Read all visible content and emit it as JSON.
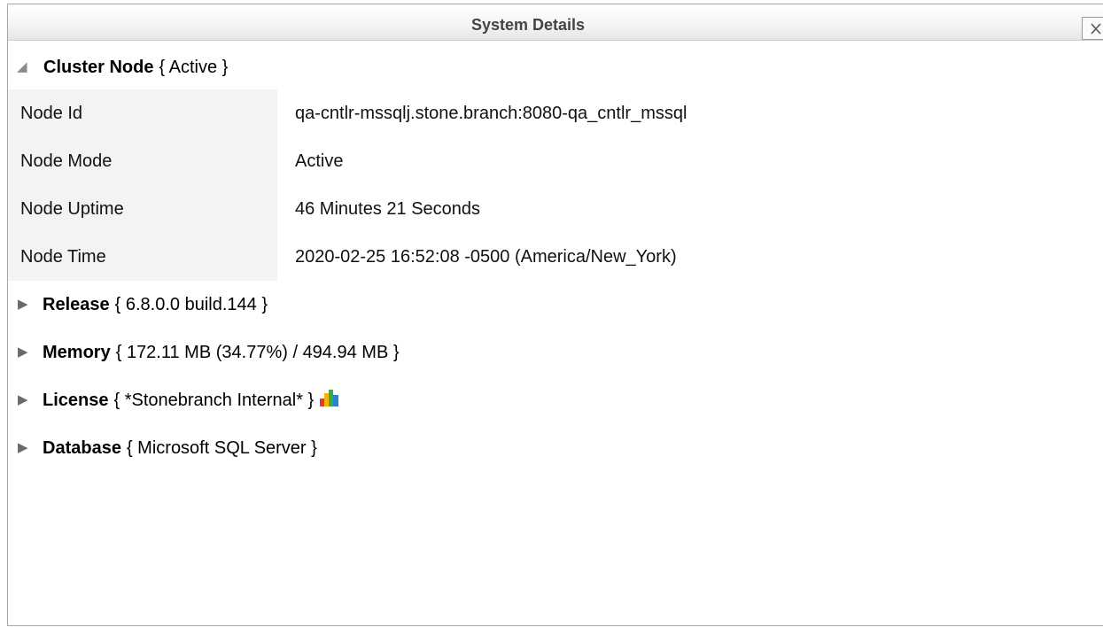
{
  "window": {
    "title": "System Details",
    "close_symbol": "✕"
  },
  "cluster_node": {
    "title": "Cluster Node",
    "summary": "{ Active }",
    "expanded": true,
    "rows": [
      {
        "label": "Node Id",
        "value": "qa-cntlr-mssqlj.stone.branch:8080-qa_cntlr_mssql"
      },
      {
        "label": "Node Mode",
        "value": "Active"
      },
      {
        "label": "Node Uptime",
        "value": "46 Minutes 21 Seconds"
      },
      {
        "label": "Node Time",
        "value": "2020-02-25 16:52:08 -0500 (America/New_York)"
      }
    ]
  },
  "sections": [
    {
      "title": "Release",
      "summary": "{ 6.8.0.0 build.144 }",
      "expanded": false
    },
    {
      "title": "Memory",
      "summary": "{ 172.11 MB (34.77%) / 494.94 MB }",
      "expanded": false
    },
    {
      "title": "License",
      "summary": "{ *Stonebranch Internal* }",
      "expanded": false,
      "icon": "bar-chart-icon"
    },
    {
      "title": "Database",
      "summary": "{ Microsoft SQL Server }",
      "expanded": false
    }
  ],
  "icons": {
    "expanded_arrow": "◢",
    "collapsed_arrow": "▶"
  },
  "colors": {
    "chart_red": "#e03a2a",
    "chart_yellow": "#f2b705",
    "chart_green": "#39a845",
    "chart_blue": "#2d7fd3"
  }
}
